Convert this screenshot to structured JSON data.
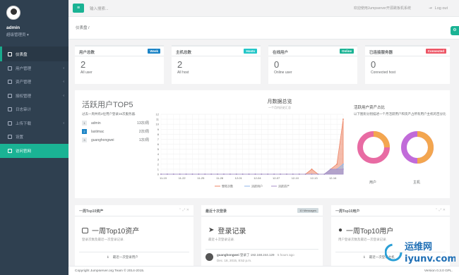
{
  "profile": {
    "name": "admin",
    "role": "超级管理员"
  },
  "nav": [
    {
      "label": "仪表盘"
    },
    {
      "label": "用户管理"
    },
    {
      "label": "资产管理"
    },
    {
      "label": "授权管理"
    },
    {
      "label": "日志审计"
    },
    {
      "label": "上传下载"
    },
    {
      "label": "设置"
    },
    {
      "label": "访问官网"
    }
  ],
  "topbar": {
    "search_placeholder": "输入搜索...",
    "welcome": "欢迎使用Jumpserver开源跳板机系统",
    "logout": "Log out"
  },
  "breadcrumb": "仪表盘 /",
  "stats": [
    {
      "title": "用户总数",
      "badge": "Week",
      "badge_color": "#1c84c6",
      "value": "2",
      "label": "All user"
    },
    {
      "title": "主机总数",
      "badge": "Hosts",
      "badge_color": "#23c6c8",
      "value": "2",
      "label": "All host"
    },
    {
      "title": "在线用户",
      "badge": "Online",
      "badge_color": "#1ab394",
      "value": "0",
      "label": "Online user"
    },
    {
      "title": "已连接服务器",
      "badge": "Connected",
      "badge_color": "#ed5565",
      "value": "0",
      "label": "Connected host"
    }
  ],
  "top_active": {
    "title": "活跃用户TOP5",
    "desc": "过去一周共有2位用户登录16次服务器.",
    "users": [
      {
        "rank": "1",
        "name": "admin",
        "count": "13次/周"
      },
      {
        "rank": "2",
        "name": "lastimac",
        "count": "2次/周"
      },
      {
        "rank": "3",
        "name": "guanghongwei",
        "count": "1次/周"
      }
    ]
  },
  "chart_data": {
    "type": "area",
    "title": "月数据总览",
    "subtitle": "一个月内历史汇总",
    "categories": [
      "11-19",
      "11-22",
      "11-25",
      "11-28",
      "12-01",
      "12-04",
      "12-07",
      "12-10",
      "12-13",
      "12-16"
    ],
    "x_count": 30,
    "ylim": [
      0,
      12
    ],
    "yticks": [
      0,
      1,
      2,
      3,
      4,
      5,
      6,
      7,
      8,
      9,
      10,
      11,
      12
    ],
    "series": [
      {
        "name": "登陆次数",
        "color": "#ed8566",
        "values": [
          0,
          0,
          0,
          0,
          0,
          0,
          0,
          0,
          0,
          0,
          0,
          0,
          0,
          0,
          0,
          0,
          0,
          0,
          0,
          0,
          0,
          0,
          0,
          0,
          1,
          0,
          0,
          1,
          2,
          11
        ]
      },
      {
        "name": "活跃用户",
        "color": "#8fb6e8",
        "values": [
          0,
          0,
          0,
          0,
          0,
          0,
          0,
          0,
          0,
          0,
          0,
          0,
          0,
          0,
          0,
          0,
          0,
          0,
          0,
          0,
          0,
          0,
          0,
          0,
          0,
          0,
          0,
          1,
          1,
          2
        ]
      },
      {
        "name": "活跃资产",
        "color": "#a991c8",
        "values": [
          0,
          0,
          0,
          0,
          0,
          0,
          0,
          0,
          0,
          0,
          0,
          0,
          0,
          0,
          0,
          0,
          0,
          0,
          0,
          0,
          0,
          0,
          0,
          0,
          0,
          0,
          0,
          1,
          1,
          1
        ]
      }
    ],
    "grid": true,
    "legend": "bottom"
  },
  "pie": {
    "title": "活跃用户资产占比",
    "desc": "以下图形分别描述一个月活跃用户和资产占所有用户主机的百分比",
    "user_label": "用户",
    "host_label": "主机",
    "ring_colors": [
      "#e86ba3",
      "#f3a64f",
      "#c16bd9"
    ]
  },
  "panels": {
    "assets": {
      "header": "一周Top10资产",
      "big": "一周Top10资产",
      "sub": "登录次数及最近一次登录记录.",
      "item": "最近一次登录用户"
    },
    "logins": {
      "header": "最近十次登录",
      "badge": "10 Messages",
      "big": "登录记录",
      "sub": "最近十次登录记录.",
      "user": "guanghongwei",
      "action": "登录了 192.168.244.129",
      "ago": "5 hours ago",
      "time": "Dec. 18, 2015, 8:52 p.m."
    },
    "users": {
      "header": "一周Top10用户",
      "big": "一周Top10用户",
      "sub": "用户登录次数及最近一次登录记录.",
      "item": "最近一次登录主机"
    }
  },
  "footer": {
    "copyright": "Copyright Jumpserver.org Team © 2014-2015.",
    "version": "Version 0.3.0 GPL."
  },
  "watermark": {
    "brand": "运维网",
    "domain": "iyunv.com"
  }
}
